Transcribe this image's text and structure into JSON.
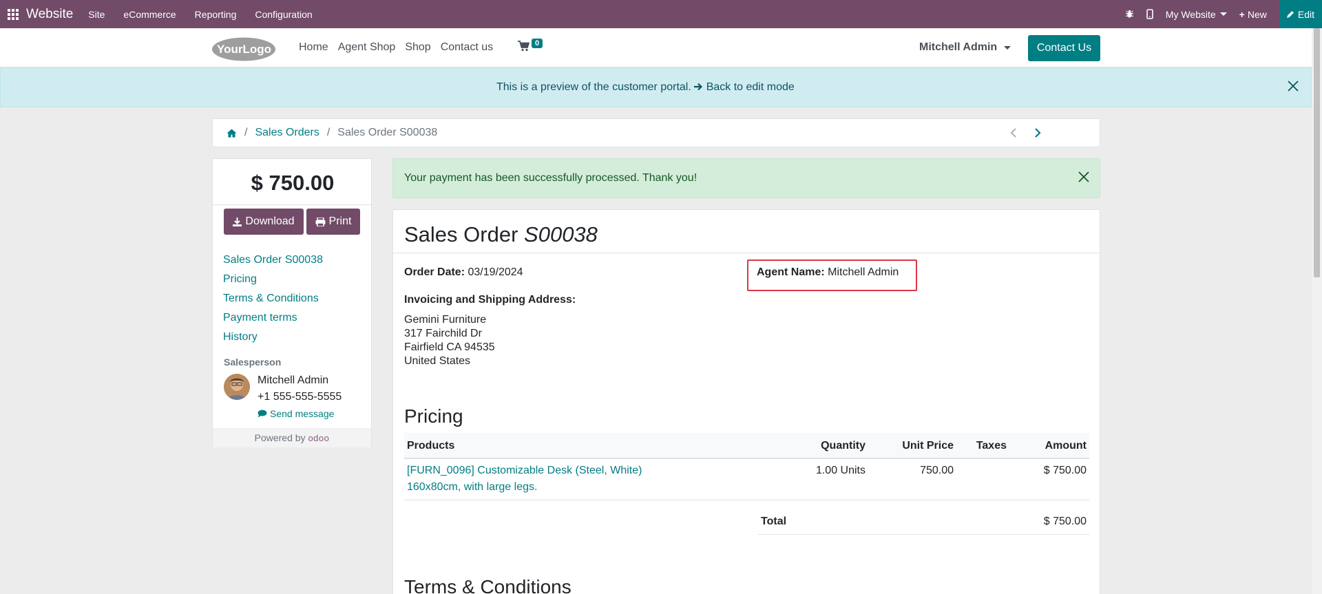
{
  "admin_bar": {
    "brand": "Website",
    "menu": [
      "Site",
      "eCommerce",
      "Reporting",
      "Configuration"
    ],
    "website_switch": "My Website",
    "new_label": "New",
    "edit_label": "Edit"
  },
  "header": {
    "logo_text": "YourLogo",
    "nav": [
      "Home",
      "Agent Shop",
      "Shop",
      "Contact us"
    ],
    "cart_count": "0",
    "user_name": "Mitchell Admin",
    "contact_button": "Contact Us"
  },
  "preview_banner": {
    "text": "This is a preview of the customer portal.",
    "back_link": "Back to edit mode"
  },
  "breadcrumb": {
    "sales_orders": "Sales Orders",
    "current": "Sales Order S00038"
  },
  "sidebar": {
    "amount": "$ 750.00",
    "download_label": "Download",
    "print_label": "Print",
    "links": [
      "Sales Order S00038",
      "Pricing",
      "Terms & Conditions",
      "Payment terms",
      "History"
    ],
    "salesperson_label": "Salesperson",
    "salesperson_name": "Mitchell Admin",
    "salesperson_phone": "+1 555-555-5555",
    "send_message": "Send message",
    "powered_by": "Powered by",
    "powered_brand": "odoo"
  },
  "success_alert": {
    "text": "Your payment has been successfully processed. Thank you!"
  },
  "order": {
    "title_prefix": "Sales Order",
    "title_ref": "S00038",
    "order_date_label": "Order Date:",
    "order_date": "03/19/2024",
    "agent_label": "Agent Name:",
    "agent_name": "Mitchell Admin",
    "address_label": "Invoicing and Shipping Address:",
    "address_lines": [
      "Gemini Furniture",
      "317 Fairchild Dr",
      "Fairfield CA 94535",
      "United States"
    ],
    "pricing_heading": "Pricing",
    "columns": [
      "Products",
      "Quantity",
      "Unit Price",
      "Taxes",
      "Amount"
    ],
    "lines": [
      {
        "product_line1": "[FURN_0096] Customizable Desk (Steel, White)",
        "product_line2": "160x80cm, with large legs.",
        "quantity": "1.00 Units",
        "unit_price": "750.00",
        "taxes": "",
        "amount": "$ 750.00"
      }
    ],
    "total_label": "Total",
    "total_amount": "$ 750.00",
    "terms_heading": "Terms & Conditions"
  },
  "colors": {
    "admin_bar": "#714b67",
    "accent": "#017e84",
    "highlight_border": "#dc3545"
  }
}
